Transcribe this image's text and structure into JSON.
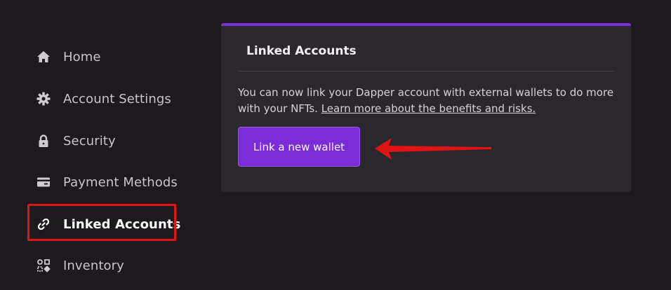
{
  "sidebar": {
    "items": [
      {
        "label": "Home",
        "icon": "home-icon"
      },
      {
        "label": "Account Settings",
        "icon": "gear-icon"
      },
      {
        "label": "Security",
        "icon": "lock-icon"
      },
      {
        "label": "Payment Methods",
        "icon": "credit-card-icon"
      },
      {
        "label": "Linked Accounts",
        "icon": "link-icon",
        "active": true
      },
      {
        "label": "Inventory",
        "icon": "inventory-icon"
      }
    ]
  },
  "card": {
    "title": "Linked Accounts",
    "description": "You can now link your Dapper account with external wallets to do more with your NFTs.",
    "link_text": "Learn more about the benefits and risks.",
    "button_label": "Link a new wallet"
  },
  "colors": {
    "background": "#1c1a1d",
    "card": "#2a282c",
    "accent": "#7b2cd6",
    "annotation": "#e01414"
  }
}
